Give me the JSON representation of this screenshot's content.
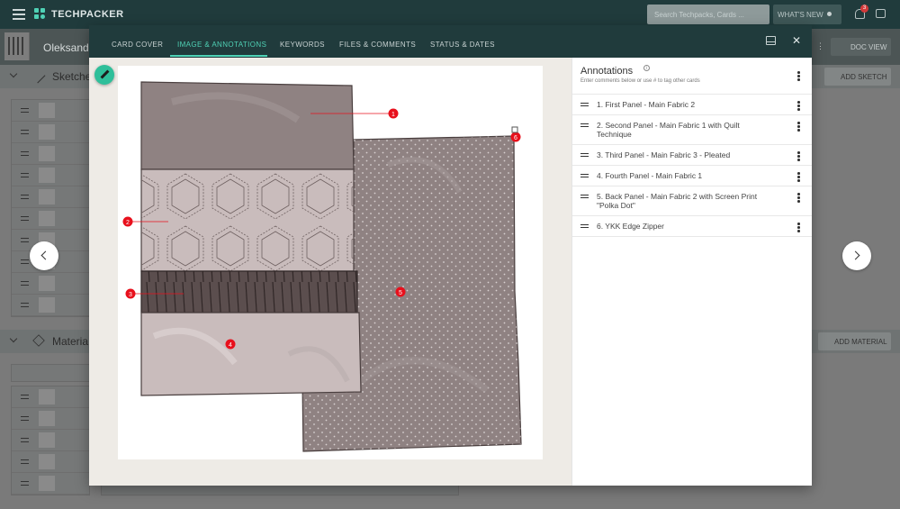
{
  "app": {
    "brand": "TECHPACKER"
  },
  "topbar": {
    "search_placeholder": "Search Techpacks, Cards ...",
    "whats_new": "WHAT'S NEW",
    "notification_count": "3"
  },
  "background": {
    "techpack_name": "Oleksand",
    "doc_view": "DOC VIEW",
    "sketches_title": "Sketche",
    "add_sketch": "ADD SKETCH",
    "materials_title": "Materia",
    "add_material": "ADD MATERIAL"
  },
  "modal": {
    "tabs": [
      {
        "label": "CARD COVER"
      },
      {
        "label": "IMAGE & ANNOTATIONS"
      },
      {
        "label": "KEYWORDS"
      },
      {
        "label": "FILES & COMMENTS"
      },
      {
        "label": "STATUS & DATES"
      }
    ],
    "active_tab": "IMAGE & ANNOTATIONS"
  },
  "annotations": {
    "title": "Annotations",
    "subtitle": "Enter comments below or use # to tag other cards",
    "items": [
      {
        "label": "1.  First Panel - Main Fabric 2"
      },
      {
        "label": "2.  Second Panel - Main Fabric 1 with Quilt Technique"
      },
      {
        "label": "3.  Third Panel - Main Fabric 3 - Pleated"
      },
      {
        "label": "4.  Fourth Panel - Main Fabric 1"
      },
      {
        "label": "5.  Back Panel - Main Fabric 2 with Screen Print \"Polka Dot\""
      },
      {
        "label": "6.  YKK Edge Zipper"
      }
    ]
  },
  "markers": {
    "m1": "1",
    "m2": "2",
    "m3": "3",
    "m4": "4",
    "m5": "5",
    "m6": "6"
  },
  "colors": {
    "header_bg": "#203b3c",
    "accent": "#4fd1b5",
    "marker_red": "#e8101c",
    "panel_dark": "#8f8282",
    "panel_light": "#c9bcbc",
    "pleat_dark": "#5b4e4e"
  }
}
